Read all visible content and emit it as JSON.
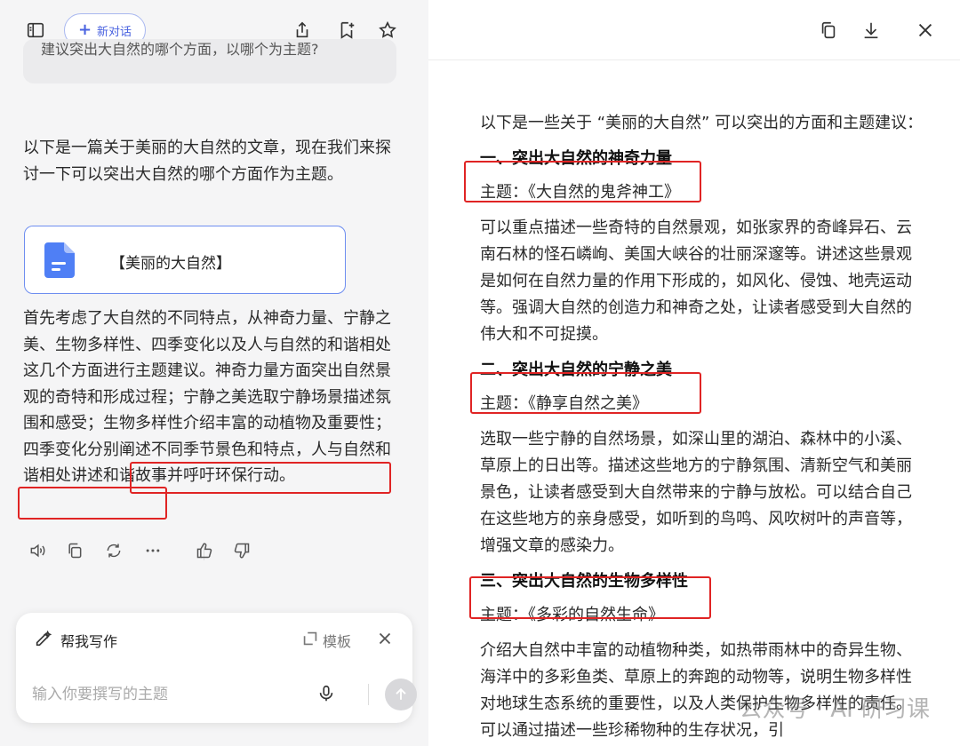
{
  "toolbar": {
    "new_chat_label": "新对话"
  },
  "previous_message": {
    "text": "建议突出大自然的哪个方面，以哪个为主题?"
  },
  "assistant": {
    "intro": "以下是一篇关于美丽的大自然的文章，现在我们来探讨一下可以突出大自然的哪个方面作为主题。",
    "doc_card_title": "【美丽的大自然】",
    "answer": "首先考虑了大自然的不同特点，从神奇力量、宁静之美、生物多样性、四季变化以及人与自然的和谐相处这几个方面进行主题建议。神奇力量方面突出自然景观的奇特和形成过程；宁静之美选取宁静场景描述氛围和感受；生物多样性介绍丰富的动植物及重要性；四季变化分别阐述不同季节景色和特点，人与自然和谐相处讲述和谐故事并呼吁环保行动。"
  },
  "composer": {
    "write_label": "帮我写作",
    "template_label": "模板",
    "placeholder": "输入你要撰写的主题"
  },
  "document": {
    "intro": "以下是一些关于 “美丽的大自然” 可以突出的方面和主题建议：",
    "sections": [
      {
        "heading": "一、突出大自然的神奇力量",
        "theme": "主题：《大自然的鬼斧神工》",
        "body": "可以重点描述一些奇特的自然景观，如张家界的奇峰异石、云南石林的怪石嶙峋、美国大峡谷的壮丽深邃等。讲述这些景观是如何在自然力量的作用下形成的，如风化、侵蚀、地壳运动等。强调大自然的创造力和神奇之处，让读者感受到大自然的伟大和不可捉摸。"
      },
      {
        "heading": "二、突出大自然的宁静之美",
        "theme": "主题：《静享自然之美》",
        "body": "选取一些宁静的自然场景，如深山里的湖泊、森林中的小溪、草原上的日出等。描述这些地方的宁静氛围、清新空气和美丽景色，让读者感受到大自然带来的宁静与放松。可以结合自己在这些地方的亲身感受，如听到的鸟鸣、风吹树叶的声音等，增强文章的感染力。"
      },
      {
        "heading": "三、突出大自然的生物多样性",
        "theme": "主题：《多彩的自然生命》",
        "body": "介绍大自然中丰富的动植物种类，如热带雨林中的奇异生物、海洋中的多彩鱼类、草原上的奔跑的动物等，说明生物多样性对地球生态系统的重要性，以及人类保护生物多样性的责任。可以通过描述一些珍稀物种的生存状况，引"
      }
    ]
  },
  "watermark": "公众号 · AI 研习课",
  "colors": {
    "accent": "#4a63e0",
    "highlight_box": "#e02424",
    "doc_icon": "#4f7ff5"
  }
}
